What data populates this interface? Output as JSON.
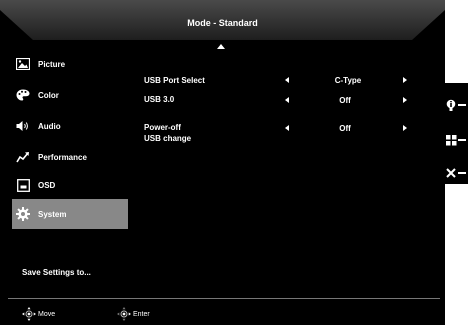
{
  "osd": {
    "title": "Mode - Standard",
    "sidebar": {
      "items": [
        {
          "label": "Picture",
          "icon": "picture-icon",
          "selected": false
        },
        {
          "label": "Color",
          "icon": "palette-icon",
          "selected": false
        },
        {
          "label": "Audio",
          "icon": "speaker-icon",
          "selected": false
        },
        {
          "label": "Performance",
          "icon": "performance-icon",
          "selected": false
        },
        {
          "label": "OSD",
          "icon": "osd-icon",
          "selected": false
        },
        {
          "label": "System",
          "icon": "gear-icon",
          "selected": true
        }
      ],
      "save_label": "Save Settings to..."
    },
    "options": [
      {
        "label": "USB Port Select",
        "value": "C-Type"
      },
      {
        "label": "USB 3.0",
        "value": "Off"
      },
      {
        "label_line1": "Power-off",
        "label_line2": "USB change",
        "value": "Off"
      }
    ],
    "footer": {
      "move_label": "Move",
      "enter_label": "Enter"
    }
  },
  "hotkeys": [
    {
      "icon": "info-icon"
    },
    {
      "icon": "menu-grid-icon"
    },
    {
      "icon": "close-icon"
    }
  ],
  "colors": {
    "background": "#000000",
    "selected": "#888888",
    "header": "#3a3a3a",
    "text": "#ffffff"
  }
}
